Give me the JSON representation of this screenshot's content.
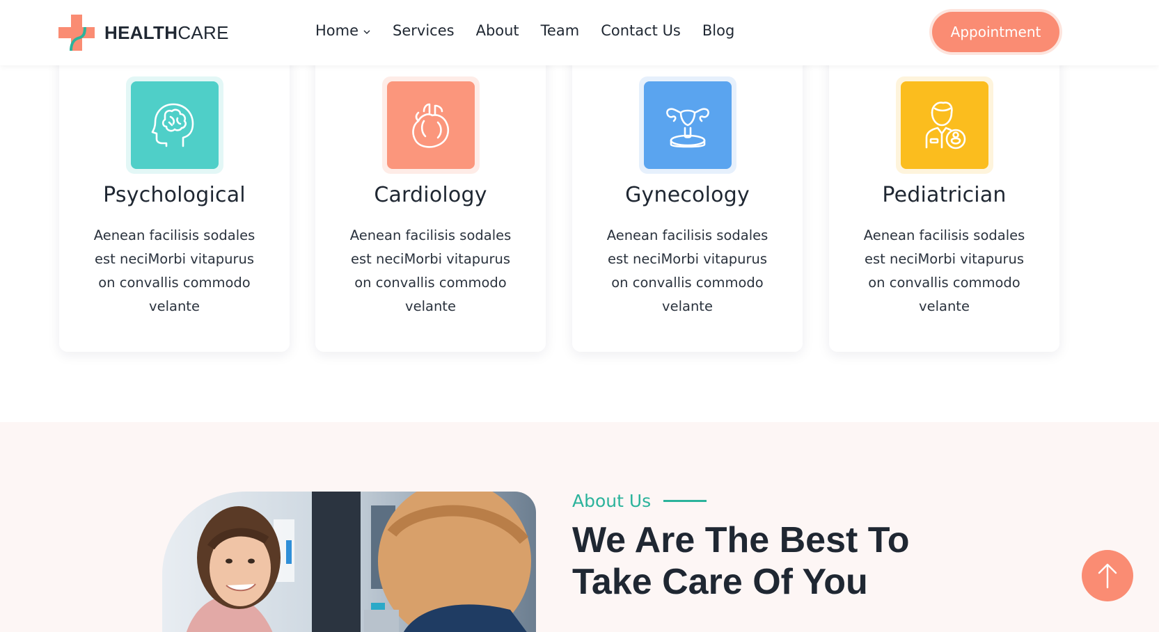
{
  "header": {
    "logo": {
      "bold": "HEALTH",
      "light": "CARE"
    },
    "nav": [
      {
        "label": "Home",
        "has_dropdown": true
      },
      {
        "label": "Services"
      },
      {
        "label": "About"
      },
      {
        "label": "Team"
      },
      {
        "label": "Contact Us"
      },
      {
        "label": "Blog"
      }
    ],
    "cta_label": "Appointment"
  },
  "services": [
    {
      "title": "Psychological",
      "text": "Aenean facilisis sodales est neciMorbi vitapurus on convallis commodo velante",
      "icon": "brain-icon",
      "color": "#4fcfc8",
      "ring": "#e3f7f6"
    },
    {
      "title": "Cardiology",
      "text": "Aenean facilisis sodales est neciMorbi vitapurus on convallis commodo velante",
      "icon": "heart-icon",
      "color": "#fb967c",
      "ring": "#feece7"
    },
    {
      "title": "Gynecology",
      "text": "Aenean facilisis sodales est neciMorbi vitapurus on convallis commodo velante",
      "icon": "uterus-icon",
      "color": "#5aa4ef",
      "ring": "#e6f0fc"
    },
    {
      "title": "Pediatrician",
      "text": "Aenean facilisis sodales est neciMorbi vitapurus on convallis commodo velante",
      "icon": "pediatrician-icon",
      "color": "#fbbd1e",
      "ring": "#fef4dc"
    }
  ],
  "about": {
    "label": "About Us",
    "heading": "We Are The Best To Take Care Of You"
  },
  "colors": {
    "accent": "#fa8c73",
    "teal": "#2bb39b",
    "dark": "#1f2732"
  }
}
